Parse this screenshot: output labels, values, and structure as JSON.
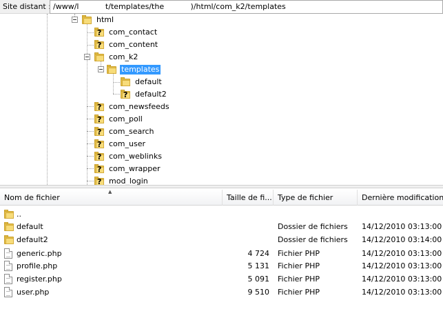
{
  "path_bar": {
    "label": "Site distant :",
    "value": "/www/l           t/templates/the           )/html/com_k2/templates"
  },
  "tree": {
    "nodes": [
      {
        "label": "html",
        "icon": "folder-open-icon"
      },
      {
        "label": "com_contact",
        "icon": "unknown-folder-icon"
      },
      {
        "label": "com_content",
        "icon": "unknown-folder-icon"
      },
      {
        "label": "com_k2",
        "icon": "folder-open-icon"
      },
      {
        "label": "templates",
        "icon": "folder-open-icon",
        "selected": true
      },
      {
        "label": "default",
        "icon": "folder-icon"
      },
      {
        "label": "default2",
        "icon": "unknown-folder-icon"
      },
      {
        "label": "com_newsfeeds",
        "icon": "unknown-folder-icon"
      },
      {
        "label": "com_poll",
        "icon": "unknown-folder-icon"
      },
      {
        "label": "com_search",
        "icon": "unknown-folder-icon"
      },
      {
        "label": "com_user",
        "icon": "unknown-folder-icon"
      },
      {
        "label": "com_weblinks",
        "icon": "unknown-folder-icon"
      },
      {
        "label": "com_wrapper",
        "icon": "unknown-folder-icon"
      },
      {
        "label": "mod_login",
        "icon": "unknown-folder-icon"
      }
    ]
  },
  "list": {
    "columns": [
      "Nom de fichier",
      "Taille de fi...",
      "Type de fichier",
      "Dernière modification"
    ],
    "rows": [
      {
        "name": "..",
        "size": "",
        "type": "",
        "modified": "",
        "icon": "folder-icon"
      },
      {
        "name": "default",
        "size": "",
        "type": "Dossier de fichiers",
        "modified": "14/12/2010 03:13:00",
        "icon": "folder-icon"
      },
      {
        "name": "default2",
        "size": "",
        "type": "Dossier de fichiers",
        "modified": "14/12/2010 03:14:00",
        "icon": "folder-icon"
      },
      {
        "name": "generic.php",
        "size": "4 724",
        "type": "Fichier PHP",
        "modified": "14/12/2010 03:13:00",
        "icon": "php-file-icon"
      },
      {
        "name": "profile.php",
        "size": "5 131",
        "type": "Fichier PHP",
        "modified": "14/12/2010 03:13:00",
        "icon": "php-file-icon"
      },
      {
        "name": "register.php",
        "size": "5 091",
        "type": "Fichier PHP",
        "modified": "14/12/2010 03:13:00",
        "icon": "php-file-icon"
      },
      {
        "name": "user.php",
        "size": "9 510",
        "type": "Fichier PHP",
        "modified": "14/12/2010 03:13:00",
        "icon": "php-file-icon"
      }
    ]
  },
  "colors": {
    "selection": "#3399ff",
    "folder": "#e8c34c"
  }
}
